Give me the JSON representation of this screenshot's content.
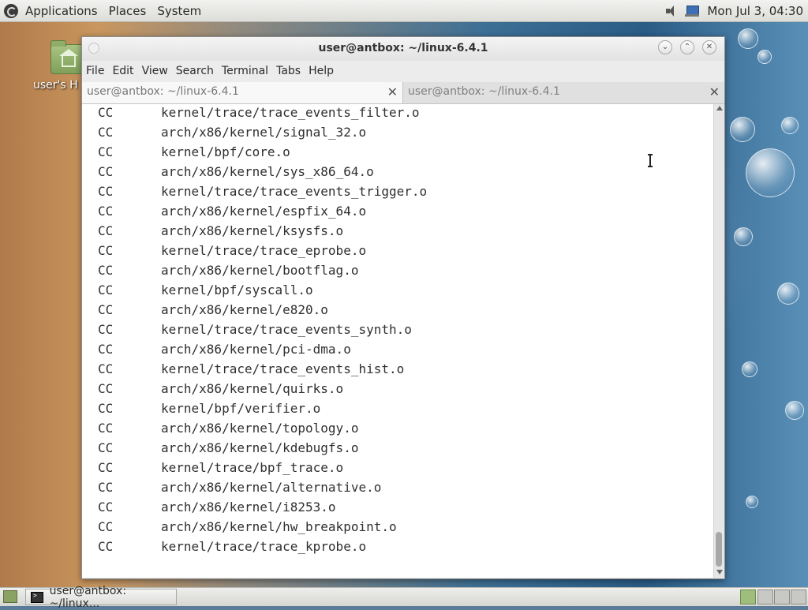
{
  "top_panel": {
    "menus": [
      "Applications",
      "Places",
      "System"
    ],
    "clock": "Mon Jul 3, 04:30"
  },
  "desktop": {
    "home_label": "user's H"
  },
  "window": {
    "title": "user@antbox: ~/linux-6.4.1",
    "menu": [
      "File",
      "Edit",
      "View",
      "Search",
      "Terminal",
      "Tabs",
      "Help"
    ],
    "tabs": [
      {
        "label": "user@antbox: ~/linux-6.4.1",
        "close": "✕"
      },
      {
        "label": "user@antbox: ~/linux-6.4.1",
        "close": "✕"
      }
    ],
    "scroll_position": 1.0
  },
  "terminal": {
    "lines": [
      {
        "cmd": "CC",
        "path": "kernel/trace/trace_events_filter.o"
      },
      {
        "cmd": "CC",
        "path": "arch/x86/kernel/signal_32.o"
      },
      {
        "cmd": "CC",
        "path": "kernel/bpf/core.o"
      },
      {
        "cmd": "CC",
        "path": "arch/x86/kernel/sys_x86_64.o"
      },
      {
        "cmd": "CC",
        "path": "kernel/trace/trace_events_trigger.o"
      },
      {
        "cmd": "CC",
        "path": "arch/x86/kernel/espfix_64.o"
      },
      {
        "cmd": "CC",
        "path": "arch/x86/kernel/ksysfs.o"
      },
      {
        "cmd": "CC",
        "path": "kernel/trace/trace_eprobe.o"
      },
      {
        "cmd": "CC",
        "path": "arch/x86/kernel/bootflag.o"
      },
      {
        "cmd": "CC",
        "path": "kernel/bpf/syscall.o"
      },
      {
        "cmd": "CC",
        "path": "arch/x86/kernel/e820.o"
      },
      {
        "cmd": "CC",
        "path": "kernel/trace/trace_events_synth.o"
      },
      {
        "cmd": "CC",
        "path": "arch/x86/kernel/pci-dma.o"
      },
      {
        "cmd": "CC",
        "path": "kernel/trace/trace_events_hist.o"
      },
      {
        "cmd": "CC",
        "path": "arch/x86/kernel/quirks.o"
      },
      {
        "cmd": "CC",
        "path": "kernel/bpf/verifier.o"
      },
      {
        "cmd": "CC",
        "path": "arch/x86/kernel/topology.o"
      },
      {
        "cmd": "CC",
        "path": "arch/x86/kernel/kdebugfs.o"
      },
      {
        "cmd": "CC",
        "path": "kernel/trace/bpf_trace.o"
      },
      {
        "cmd": "CC",
        "path": "arch/x86/kernel/alternative.o"
      },
      {
        "cmd": "CC",
        "path": "arch/x86/kernel/i8253.o"
      },
      {
        "cmd": "CC",
        "path": "arch/x86/kernel/hw_breakpoint.o"
      },
      {
        "cmd": "CC",
        "path": "kernel/trace/trace_kprobe.o"
      }
    ]
  },
  "taskbar": {
    "window_item": "user@antbox: ~/linux..."
  }
}
